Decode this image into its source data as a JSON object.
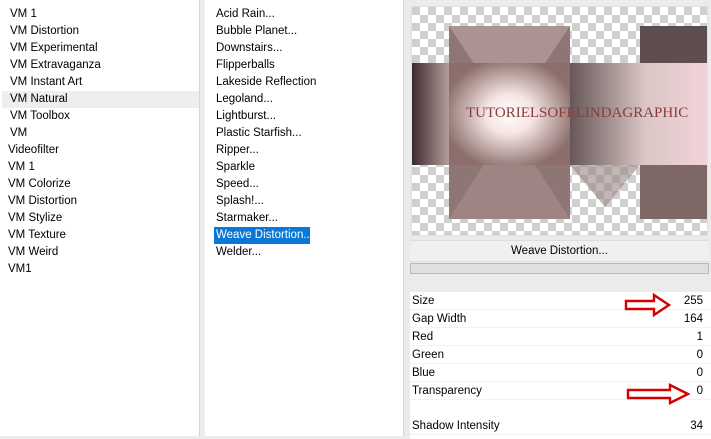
{
  "categories": [
    {
      "label": "VM 1",
      "state": "indent"
    },
    {
      "label": "VM Distortion",
      "state": "indent"
    },
    {
      "label": "VM Experimental",
      "state": "indent"
    },
    {
      "label": "VM Extravaganza",
      "state": "indent"
    },
    {
      "label": "VM Instant Art",
      "state": "indent"
    },
    {
      "label": "VM Natural",
      "state": "sel"
    },
    {
      "label": "VM Toolbox",
      "state": "indent"
    },
    {
      "label": "VM",
      "state": "indent"
    },
    {
      "label": "Videofilter",
      "state": "out"
    },
    {
      "label": "VM 1",
      "state": "out"
    },
    {
      "label": "VM Colorize",
      "state": "out"
    },
    {
      "label": "VM Distortion",
      "state": "out"
    },
    {
      "label": "VM Stylize",
      "state": "out"
    },
    {
      "label": "VM Texture",
      "state": "out"
    },
    {
      "label": "VM Weird",
      "state": "out"
    },
    {
      "label": "VM1",
      "state": "out"
    }
  ],
  "filters": [
    {
      "label": "Acid Rain...",
      "selected": false
    },
    {
      "label": "Bubble Planet...",
      "selected": false
    },
    {
      "label": "Downstairs...",
      "selected": false
    },
    {
      "label": "Flipperballs",
      "selected": false
    },
    {
      "label": "Lakeside Reflection",
      "selected": false
    },
    {
      "label": "Legoland...",
      "selected": false
    },
    {
      "label": "Lightburst...",
      "selected": false
    },
    {
      "label": "Plastic Starfish...",
      "selected": false
    },
    {
      "label": "Ripper...",
      "selected": false
    },
    {
      "label": "Sparkle",
      "selected": false
    },
    {
      "label": "Speed...",
      "selected": false
    },
    {
      "label": "Splash!...",
      "selected": false
    },
    {
      "label": "Starmaker...",
      "selected": false
    },
    {
      "label": "Weave Distortion...",
      "selected": true
    },
    {
      "label": "Welder...",
      "selected": false
    }
  ],
  "preview": {
    "watermark": "TUTORIELSOFELINDAGRAPHIC"
  },
  "filter_title": "Weave Distortion...",
  "progress": 0,
  "params": [
    {
      "label": "Size",
      "value": "255"
    },
    {
      "label": "Gap Width",
      "value": "164"
    },
    {
      "label": "Red",
      "value": "1"
    },
    {
      "label": "Green",
      "value": "0"
    },
    {
      "label": "Blue",
      "value": "0"
    },
    {
      "label": "Transparency",
      "value": "0"
    },
    {
      "label": "Shadow Intensity",
      "value": "34"
    }
  ],
  "colors": {
    "selection": "#0a78d7",
    "arrow": "#d40000"
  }
}
